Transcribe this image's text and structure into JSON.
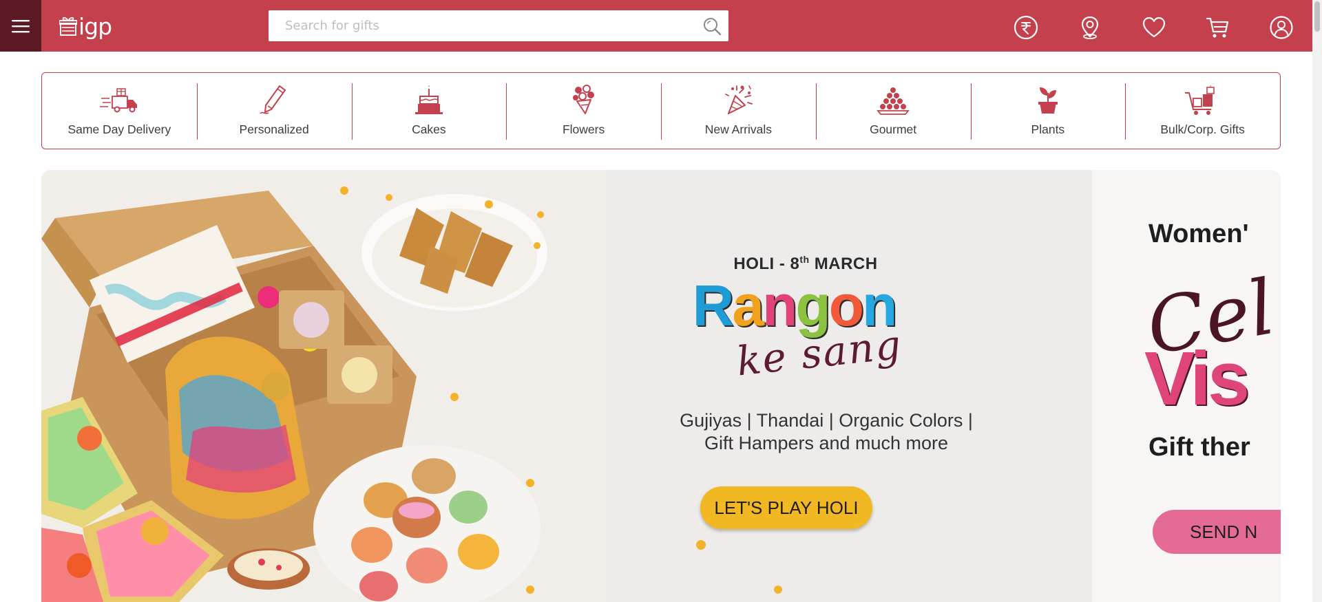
{
  "header": {
    "logo_text": "igp",
    "search_placeholder": "Search for gifts",
    "icons": [
      "menu-icon",
      "search-icon",
      "currency-rupee-icon",
      "location-pin-icon",
      "heart-icon",
      "cart-icon",
      "user-account-icon"
    ],
    "accent_color": "#c3404c",
    "menu_bg_color": "#5e1a24"
  },
  "categories": [
    {
      "label": "Same Day Delivery",
      "icon": "delivery-truck-icon"
    },
    {
      "label": "Personalized",
      "icon": "pencil-icon"
    },
    {
      "label": "Cakes",
      "icon": "cake-icon"
    },
    {
      "label": "Flowers",
      "icon": "bouquet-icon"
    },
    {
      "label": "New Arrivals",
      "icon": "party-popper-icon"
    },
    {
      "label": "Gourmet",
      "icon": "sweets-platter-icon"
    },
    {
      "label": "Plants",
      "icon": "potted-plant-icon"
    },
    {
      "label": "Bulk/Corp. Gifts",
      "icon": "gift-cart-icon"
    }
  ],
  "banner": {
    "date_prefix": "HOLI - 8",
    "date_sup": "th",
    "date_suffix": " MARCH",
    "title_letters": [
      "R",
      "a",
      "n",
      "g",
      "o",
      "n"
    ],
    "title_colors": [
      "#1f9bd6",
      "#f0a21e",
      "#e2427a",
      "#8bc23f",
      "#f05a3a",
      "#27a7e0"
    ],
    "script": "ke sang",
    "subtitle_line1": "Gujiyas | Thandai | Organic Colors |",
    "subtitle_line2": "Gift Hampers and much more",
    "cta": "LET'S PLAY HOLI",
    "cta_color": "#f2b823"
  },
  "next_banner": {
    "title": "Women'",
    "script": "Cel",
    "big": "Vis",
    "subtitle": "Gift ther",
    "cta": "SEND N",
    "cta_color": "#e56b97"
  }
}
